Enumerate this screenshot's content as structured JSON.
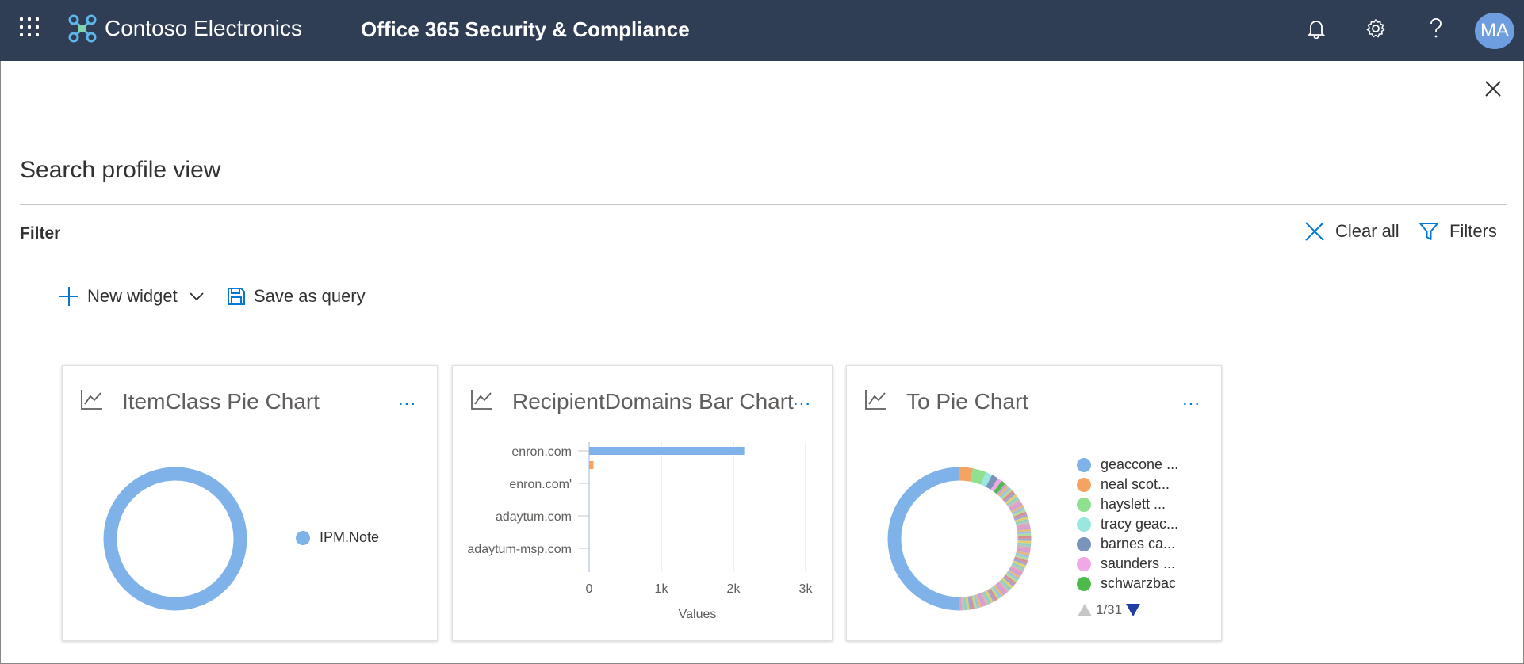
{
  "header": {
    "brand": "Contoso Electronics",
    "app_title": "Office 365 Security & Compliance",
    "avatar_initials": "MA",
    "icons": [
      "app-launcher-icon",
      "bell-icon",
      "gear-icon",
      "help-icon"
    ]
  },
  "page": {
    "title": "Search profile view",
    "filter_label": "Filter",
    "clear_all": "Clear all",
    "filters": "Filters"
  },
  "toolbar": {
    "new_widget": "New widget",
    "save_as_query": "Save as query"
  },
  "colors": {
    "header_bg": "#2f3e55",
    "accent": "#0078d4",
    "series_blue": "#7fb2e8",
    "series_orange": "#f4a460"
  },
  "widgets": [
    {
      "title": "ItemClass Pie Chart",
      "more": "...",
      "legend": [
        {
          "label": "IPM.Note",
          "color": "#7fb2e8"
        }
      ]
    },
    {
      "title": "RecipientDomains Bar Chart",
      "more": "..."
    },
    {
      "title": "To Pie Chart",
      "more": "...",
      "legend": [
        {
          "label": "geaccone ...",
          "color": "#7fb2e8"
        },
        {
          "label": "neal scot...",
          "color": "#f4a460"
        },
        {
          "label": "hayslett ...",
          "color": "#8fe08f"
        },
        {
          "label": "tracy geac...",
          "color": "#9be7e0"
        },
        {
          "label": "barnes ca...",
          "color": "#7a93b8"
        },
        {
          "label": "saunders ...",
          "color": "#f0a8e6"
        },
        {
          "label": "schwarzbac",
          "color": "#4cbb4c"
        }
      ],
      "pager": "1/31"
    }
  ],
  "chart_data": [
    {
      "type": "pie",
      "labels": [
        "IPM.Note"
      ],
      "values": [
        100
      ],
      "legend": "right"
    },
    {
      "type": "bar",
      "orientation": "horizontal",
      "categories": [
        "enron.com",
        "enron.com'",
        "adaytum.com",
        "adaytum-msp.com"
      ],
      "values": [
        2150,
        60,
        0,
        0
      ],
      "bar_colors": [
        "#7fb2e8",
        "#f4a460",
        "#7fb2e8",
        "#7fb2e8"
      ],
      "xlabel": "Values",
      "xticks": [
        "0",
        "1k",
        "2k",
        "3k"
      ],
      "xlim": [
        0,
        3000
      ],
      "grid": true
    },
    {
      "type": "pie",
      "labels": [
        "geaccone ...",
        "neal scot...",
        "hayslett ...",
        "tracy geac...",
        "barnes ca...",
        "saunders ...",
        "schwarzbac"
      ],
      "values": [
        50,
        3,
        3,
        1.5,
        1.5,
        1,
        1
      ],
      "other_share": 39,
      "legend": "right"
    }
  ]
}
